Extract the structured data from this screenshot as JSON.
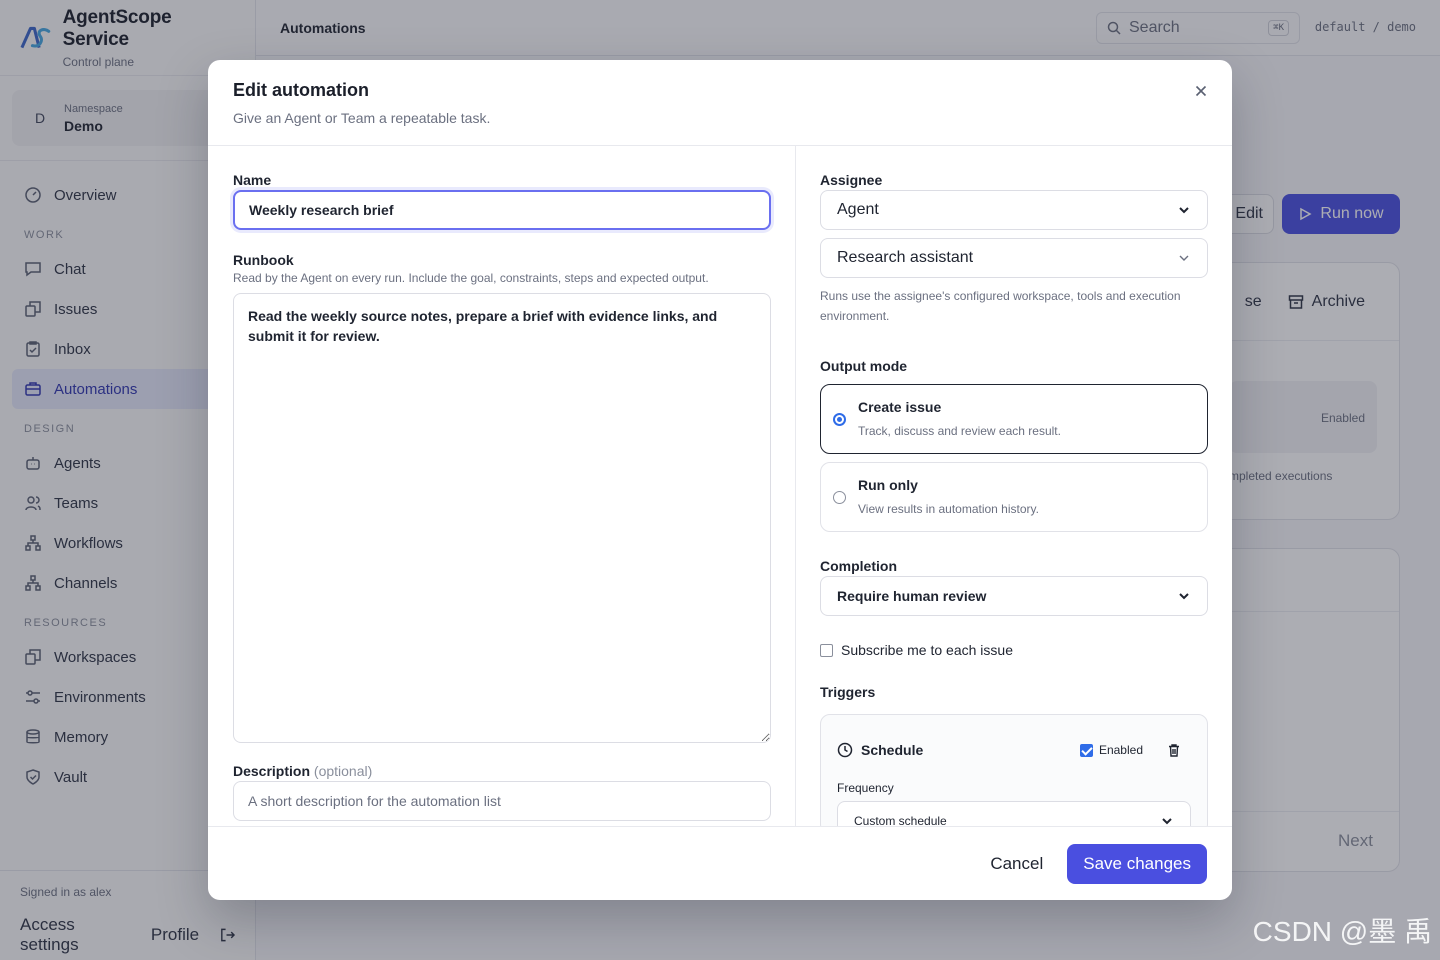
{
  "brand": {
    "title": "AgentScope Service",
    "subtitle": "Control plane"
  },
  "namespace": {
    "avatar": "D",
    "label": "Namespace",
    "value": "Demo"
  },
  "nav": {
    "overview": "Overview",
    "work_section": "WORK",
    "chat": "Chat",
    "issues": "Issues",
    "inbox": "Inbox",
    "automations": "Automations",
    "design_section": "DESIGN",
    "agents": "Agents",
    "teams": "Teams",
    "workflows": "Workflows",
    "channels": "Channels",
    "resources_section": "RESOURCES",
    "workspaces": "Workspaces",
    "environments": "Environments",
    "memory": "Memory",
    "vault": "Vault"
  },
  "footer": {
    "signed_in": "Signed in as alex",
    "access_settings": "Access settings",
    "profile": "Profile"
  },
  "topbar": {
    "title": "Automations",
    "search_placeholder": "Search",
    "shortcut": "⌘K",
    "context": "default / demo"
  },
  "background": {
    "edit": "Edit",
    "run_now": "Run now",
    "archive": "Archive",
    "pause_fragment": "se",
    "status": "Enabled",
    "executions_fragment": "mpleted executions",
    "next": "Next"
  },
  "modal": {
    "title": "Edit automation",
    "subtitle": "Give an Agent or Team a repeatable task.",
    "name_label": "Name",
    "name_value": "Weekly research brief",
    "runbook_label": "Runbook",
    "runbook_hint": "Read by the Agent on every run. Include the goal, constraints, steps and expected output.",
    "runbook_value": "Read the weekly source notes, prepare a brief with evidence links, and submit it for review.",
    "description_label": "Description",
    "description_optional": "(optional)",
    "description_placeholder": "A short description for the automation list",
    "assignee_label": "Assignee",
    "assignee_type": "Agent",
    "assignee_value": "Research assistant",
    "assignee_hint": "Runs use the assignee's configured workspace, tools and execution environment.",
    "output_label": "Output mode",
    "output_create_title": "Create issue",
    "output_create_desc": "Track, discuss and review each result.",
    "output_run_title": "Run only",
    "output_run_desc": "View results in automation history.",
    "completion_label": "Completion",
    "completion_value": "Require human review",
    "subscribe_label": "Subscribe me to each issue",
    "triggers_label": "Triggers",
    "trigger_title": "Schedule",
    "trigger_enabled": "Enabled",
    "frequency_label": "Frequency",
    "frequency_value": "Custom schedule",
    "cancel": "Cancel",
    "save": "Save changes"
  },
  "watermark": "CSDN @墨 禹"
}
